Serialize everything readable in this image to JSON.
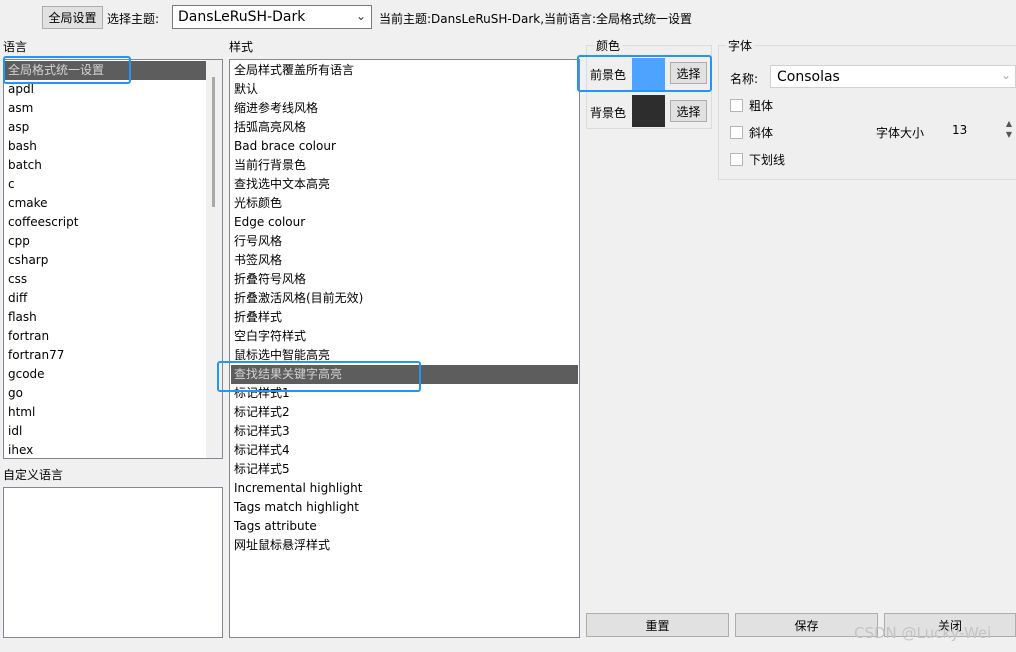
{
  "toolbar": {
    "global_button": "全局设置",
    "theme_label": "选择主题:",
    "theme_value": "DansLeRuSH-Dark",
    "status": "当前主题:DansLeRuSH-Dark,当前语言:全局格式统一设置"
  },
  "language": {
    "title": "语言",
    "items": [
      "全局格式统一设置",
      "apdl",
      "asm",
      "asp",
      "bash",
      "batch",
      "c",
      "cmake",
      "coffeescript",
      "cpp",
      "csharp",
      "css",
      "diff",
      "flash",
      "fortran",
      "fortran77",
      "gcode",
      "go",
      "html",
      "idl",
      "ihex"
    ],
    "selected_index": 0
  },
  "custom_language": {
    "title": "自定义语言"
  },
  "style": {
    "title": "样式",
    "items": [
      "全局样式覆盖所有语言",
      "默认",
      "缩进参考线风格",
      "括弧高亮风格",
      "Bad brace colour",
      "当前行背景色",
      "查找选中文本高亮",
      "光标颜色",
      "Edge colour",
      "行号风格",
      "书签风格",
      "折叠符号风格",
      "折叠激活风格(目前无效)",
      "折叠样式",
      "空白字符样式",
      "鼠标选中智能高亮",
      "查找结果关键字高亮",
      "标记样式1",
      "标记样式2",
      "标记样式3",
      "标记样式4",
      "标记样式5",
      "Incremental highlight",
      "Tags match highlight",
      "Tags attribute",
      "网址鼠标悬浮样式"
    ],
    "selected_index": 16
  },
  "color": {
    "title": "颜色",
    "fg_label": "前景色",
    "bg_label": "背景色",
    "choose_label": "选择",
    "fg_color": "#4da3ff",
    "bg_color": "#2d2d2d"
  },
  "font": {
    "title": "字体",
    "name_label": "名称:",
    "name_value": "Consolas",
    "bold_label": "粗体",
    "italic_label": "斜体",
    "underline_label": "下划线",
    "size_label": "字体大小",
    "size_value": "13"
  },
  "actions": {
    "reset": "重置",
    "save": "保存",
    "close": "关闭"
  },
  "watermark": "CSDN @Lucky-Wei"
}
